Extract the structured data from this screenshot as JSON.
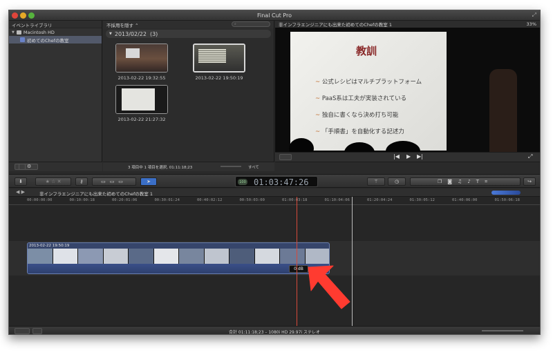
{
  "window": {
    "title": "Final Cut Pro"
  },
  "library": {
    "header": "イベントライブラリ",
    "disk": "Macintosh HD",
    "event": "初めてのChefの教室"
  },
  "browser": {
    "filter": "不採用を隠す ⌃",
    "search_placeholder": "",
    "date_group": "2013/02/22",
    "date_count": "(3)",
    "clips": [
      {
        "label": "2013-02-22 19:32:55"
      },
      {
        "label": "2013-02-22 19:50:19"
      },
      {
        "label": "2013-02-22 21:27:32"
      }
    ],
    "status": "3 項目中 1 項目を選択, 01:11:18;23",
    "filter_all": "すべて"
  },
  "viewer": {
    "title": "非インフラエンジニアにも出来た初めてのChefの教室 1",
    "zoom": "33%",
    "slide": {
      "title": "教訓",
      "bullets": [
        "公式レシピはマルチプラットフォーム",
        "PaaS系は工夫が実装されている",
        "独自に書くなら決め打ち可能",
        "「手順書」を自動化する記述力"
      ]
    }
  },
  "toolbar": {
    "timecode_badge": "100",
    "timecode": "01:03:47:26"
  },
  "timeline": {
    "title": "非インフラエンジニアにも出来た初めてのChefの教室 1",
    "ruler": [
      "00:00:00:00",
      "00:10:00:18",
      "00:20:01:06",
      "00:30:01:24",
      "00:40:02:12",
      "00:50:03:00",
      "01:00:03:18",
      "01:10:04:06",
      "01:20:04:24",
      "01:30:05:12",
      "01:40:06:00",
      "01:50:06:18"
    ],
    "clip_name": "2013-02-22 19:50:19",
    "volume": "0 dB"
  },
  "status": {
    "summary": "合計 01:11:18;23 – 1080i HD 29.97i ステレオ"
  },
  "colors": {
    "clip": "#36456b",
    "playhead": "#d84a3a",
    "arrow": "#ff3b30"
  }
}
